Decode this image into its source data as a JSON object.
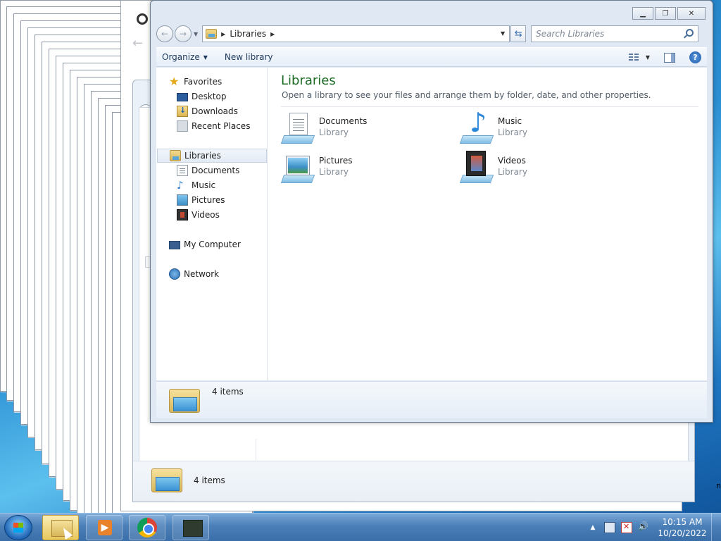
{
  "window": {
    "address": {
      "crumb": "Libraries"
    },
    "search": {
      "placeholder": "Search Libraries"
    },
    "toolbar": {
      "organize": "Organize",
      "new_library": "New library"
    },
    "nav": {
      "favorites": "Favorites",
      "desktop": "Desktop",
      "downloads": "Downloads",
      "recent": "Recent Places",
      "libraries": "Libraries",
      "documents": "Documents",
      "music": "Music",
      "pictures": "Pictures",
      "videos": "Videos",
      "computer": "My Computer",
      "network": "Network"
    },
    "main": {
      "title": "Libraries",
      "subtitle": "Open a library to see your files and arrange them by folder, date, and other properties.",
      "items": [
        {
          "name": "Documents",
          "kind": "Library",
          "icon": "documents-library-icon"
        },
        {
          "name": "Music",
          "kind": "Library",
          "icon": "music-library-icon"
        },
        {
          "name": "Pictures",
          "kind": "Library",
          "icon": "pictures-library-icon"
        },
        {
          "name": "Videos",
          "kind": "Library",
          "icon": "videos-library-icon"
        }
      ]
    },
    "status": "4 items"
  },
  "background_window": {
    "status": "4 items"
  },
  "taskbar": {
    "apps": [
      "windows-explorer",
      "windows-media-player",
      "google-chrome",
      "task-manager"
    ],
    "active_app": "windows-explorer",
    "clock": {
      "time": "10:15 AM",
      "date": "10/20/2022"
    }
  },
  "colors": {
    "library_title": "#1b6b24",
    "taskbar": "#4a7fb8",
    "selection": "#e3ebf5"
  }
}
